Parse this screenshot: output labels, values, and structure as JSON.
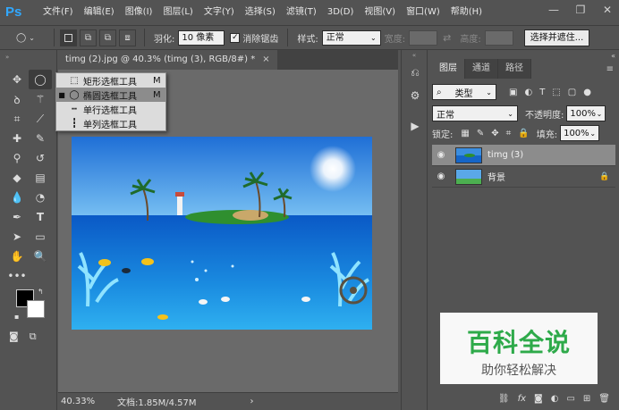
{
  "app": {
    "logo": "Ps"
  },
  "menu": [
    "文件(F)",
    "编辑(E)",
    "图像(I)",
    "图层(L)",
    "文字(Y)",
    "选择(S)",
    "滤镜(T)",
    "3D(D)",
    "视图(V)",
    "窗口(W)",
    "帮助(H)"
  ],
  "window_controls": {
    "minimize": "—",
    "restore": "❐",
    "close": "✕"
  },
  "options": {
    "feather_label": "羽化:",
    "feather_value": "10 像素",
    "antialias_label": "消除锯齿",
    "antialias_checked": true,
    "style_label": "样式:",
    "style_value": "正常",
    "width_label": "宽度:",
    "height_label": "高度:",
    "select_mask_button": "选择并遮住..."
  },
  "document": {
    "tab_title": "timg (2).jpg @ 40.3% (timg (3), RGB/8#) *",
    "close_glyph": "×",
    "zoom": "40.33%",
    "doc_info": "文档:1.85M/4.57M"
  },
  "flyout": {
    "items": [
      {
        "bullet": "",
        "icon": "rect-marquee-icon",
        "glyph": "⬚",
        "label": "矩形选框工具",
        "key": "M",
        "active": false
      },
      {
        "bullet": "■",
        "icon": "ellipse-marquee-icon",
        "glyph": "◯",
        "label": "椭圆选框工具",
        "key": "M",
        "active": true
      },
      {
        "bullet": "",
        "icon": "single-row-marquee-icon",
        "glyph": "┅",
        "label": "单行选框工具",
        "key": "",
        "active": false
      },
      {
        "bullet": "",
        "icon": "single-column-marquee-icon",
        "glyph": "┇",
        "label": "单列选框工具",
        "key": "",
        "active": false
      }
    ]
  },
  "panel": {
    "tabs": [
      "图层",
      "通道",
      "路径"
    ],
    "active_tab": 0,
    "filter_kind": "类型",
    "blend_mode": "正常",
    "opacity_label": "不透明度:",
    "opacity_value": "100%",
    "lock_label": "锁定:",
    "fill_label": "填充:",
    "fill_value": "100%",
    "layers": [
      {
        "name": "timg (3)",
        "visible": true,
        "selected": true,
        "locked": false
      },
      {
        "name": "背景",
        "visible": true,
        "selected": false,
        "locked": true
      }
    ]
  },
  "watermark": {
    "title": "百科全说",
    "subtitle": "助你轻松解决"
  },
  "colors": {
    "accent": "#31a8ff",
    "ui_bg": "#535353",
    "canvas_bg": "#6a6a6a",
    "watermark_green": "#2eaa4a"
  }
}
